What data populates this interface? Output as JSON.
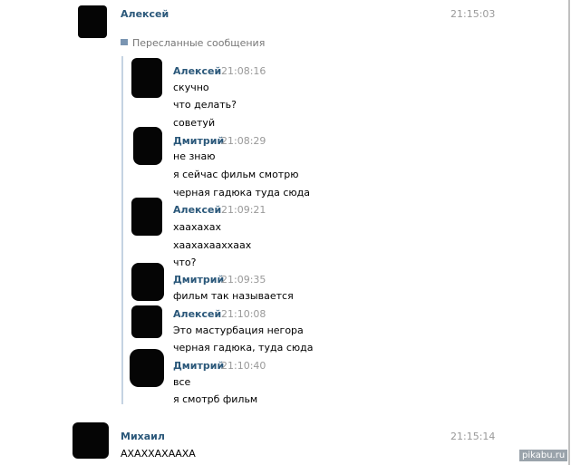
{
  "top": {
    "sender": "Алексей",
    "time": "21:15:03"
  },
  "forwarded_label": "Пересланные сообщения",
  "forwarded": [
    {
      "sender": "Алексей",
      "time": "21:08:16",
      "lines": [
        "скучно",
        "что делать?",
        "советуй"
      ]
    },
    {
      "sender": "Дмитрий",
      "time": "21:08:29",
      "lines": [
        "не знаю",
        "я сейчас фильм смотрю",
        "черная гадюка туда сюда"
      ]
    },
    {
      "sender": "Алексей",
      "time": "21:09:21",
      "lines": [
        "хаахахах",
        "хаахахааххаах",
        "что?"
      ]
    },
    {
      "sender": "Дмитрий",
      "time": "21:09:35",
      "lines": [
        "фильм так называется"
      ]
    },
    {
      "sender": "Алексей",
      "time": "21:10:08",
      "lines": [
        "Это мастурбация негора",
        "черная гадюка, туда сюда"
      ]
    },
    {
      "sender": "Дмитрий",
      "time": "21:10:40",
      "lines": [
        "все",
        "я смотрб фильм"
      ]
    }
  ],
  "bottom": {
    "sender": "Михаил",
    "time": "21:15:14",
    "text": "АХАХХАХААХА"
  },
  "watermark": "pikabu.ru",
  "colors": {
    "name": "#2b587a",
    "time": "#999999",
    "forward_bar": "#c5d3e2"
  },
  "icons": {
    "forward": "speech-bubble-icon"
  }
}
